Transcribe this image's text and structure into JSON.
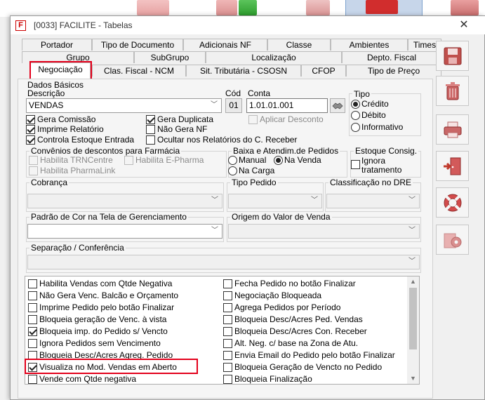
{
  "window": {
    "title": "[0033] FACILITE - Tabelas",
    "app_icon_letter": "F",
    "close_glyph": "✕"
  },
  "tabs": {
    "row1": [
      "Portador",
      "Tipo de Documento",
      "Adicionais NF",
      "Classe",
      "Ambientes",
      "Times"
    ],
    "row2": [
      "Grupo",
      "SubGrupo",
      "Localização",
      "Depto. Fiscal"
    ],
    "row3": [
      "Negociação",
      "Clas. Fiscal - NCM",
      "Sit. Tributária - CSOSN",
      "CFOP",
      "Tipo de Preço"
    ],
    "active": "Negociação"
  },
  "dados_basicos": {
    "section_title": "Dados Básicos",
    "descricao_label": "Descrição",
    "descricao_value": "VENDAS",
    "cod_label": "Cód",
    "cod_value": "01",
    "conta_label": "Conta",
    "conta_value": "1.01.01.001",
    "tipo_label": "Tipo",
    "tipo_options": [
      "Crédito",
      "Débito",
      "Informativo"
    ],
    "tipo_selected": "Crédito"
  },
  "flags": {
    "gera_comissao": {
      "label": "Gera Comissão",
      "checked": true
    },
    "imprime_relatorio": {
      "label": "Imprime Relatório",
      "checked": true
    },
    "controla_estoque_entrada": {
      "label": "Controla Estoque Entrada",
      "checked": true
    },
    "gera_duplicata": {
      "label": "Gera Duplicata",
      "checked": true
    },
    "nao_gera_nf": {
      "label": "Não Gera NF",
      "checked": false
    },
    "ocultar_relatorios": {
      "label": "Ocultar nos Relatórios do C. Receber",
      "checked": false
    },
    "aplicar_desconto": {
      "label": "Aplicar Desconto",
      "checked": false
    }
  },
  "convenios": {
    "title": "Convênios de descontos para Farmácia",
    "items": [
      "Habilita TRNCentre",
      "Habilita E-Pharma",
      "Habilita PharmaLink"
    ]
  },
  "baixa": {
    "title": "Baixa e Atendim.de Pedidos",
    "options": [
      "Manual",
      "Na Venda",
      "Na Carga"
    ],
    "selected": "Na Venda"
  },
  "estoque_consig": {
    "title": "Estoque Consig.",
    "label_line1": "Ignora",
    "label_line2": "tratamento"
  },
  "combos": {
    "cobranca": "Cobrança",
    "tipo_pedido": "Tipo Pedido",
    "classificacao_dre": "Classificação no DRE",
    "padrao_cor": "Padrão de Cor na Tela de Gerenciamento",
    "origem_valor": "Origem do Valor de Venda",
    "separacao": "Separação / Conferência",
    "chevron": "﹀"
  },
  "options_list": {
    "left": [
      {
        "label": "Habilita Vendas com Qtde Negativa",
        "checked": false
      },
      {
        "label": "Não Gera Venc. Balcão e Orçamento",
        "checked": false
      },
      {
        "label": "Imprime Pedido pelo botão Finalizar",
        "checked": false
      },
      {
        "label": "Bloqueia geração de Venc. à vista",
        "checked": false
      },
      {
        "label": "Bloqueia imp. do Pedido s/ Vencto",
        "checked": true
      },
      {
        "label": "Ignora Pedidos sem Vencimento",
        "checked": false
      },
      {
        "label": "Bloqueia Desc/Acres Agreg. Pedido",
        "checked": false
      },
      {
        "label": "Visualiza no Mod. Vendas em Aberto",
        "checked": true
      },
      {
        "label": "Vende com Qtde negativa",
        "checked": false
      }
    ],
    "right": [
      {
        "label": "Fecha Pedido no botão Finalizar",
        "checked": false
      },
      {
        "label": "Negociação Bloqueada",
        "checked": false
      },
      {
        "label": "Agrega Pedidos por Período",
        "checked": false
      },
      {
        "label": "Bloqueia Desc/Acres Ped. Vendas",
        "checked": false
      },
      {
        "label": "Bloqueia Desc/Acres Con. Receber",
        "checked": false
      },
      {
        "label": "Alt. Neg. c/ base na Zona de Atu.",
        "checked": false
      },
      {
        "label": "Envia Email do Pedido pelo botão Finalizar",
        "checked": false
      },
      {
        "label": "Bloqueia Geração de Vencto no Pedido",
        "checked": false
      },
      {
        "label": "Bloqueia Finalização",
        "checked": false
      }
    ]
  },
  "toolbar": [
    "save-icon",
    "trash-icon",
    "printer-icon",
    "exit-door-icon",
    "lifebuoy-icon",
    "settings-gear-icon"
  ],
  "colors": {
    "highlight": "#e3001b",
    "accent_blue": "#7da2ce"
  }
}
